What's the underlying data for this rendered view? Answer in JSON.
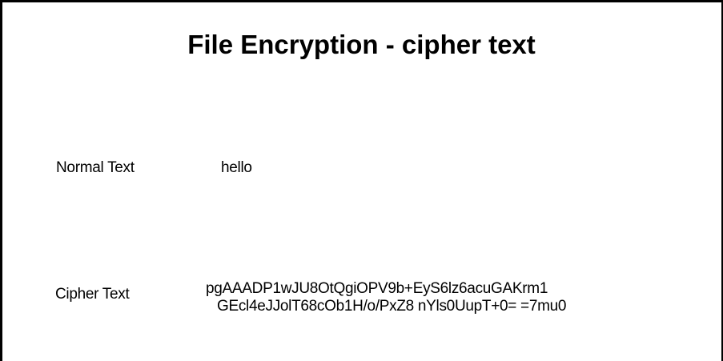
{
  "page": {
    "title": "File Encryption - cipher text"
  },
  "normal": {
    "label": "Normal Text",
    "value": "hello"
  },
  "cipher": {
    "label": "Cipher Text",
    "value_lines": [
      "pgAAADP1wJU8OtQgiOPV9b+EyS6lz6acuGAKrm1",
      "GEcl4eJJolT68cOb1H/o/PxZ8 nYls0UupT+0= =7mu0"
    ]
  },
  "colors": {
    "background": "#ffffff",
    "text": "#000000",
    "border": "#000000"
  }
}
